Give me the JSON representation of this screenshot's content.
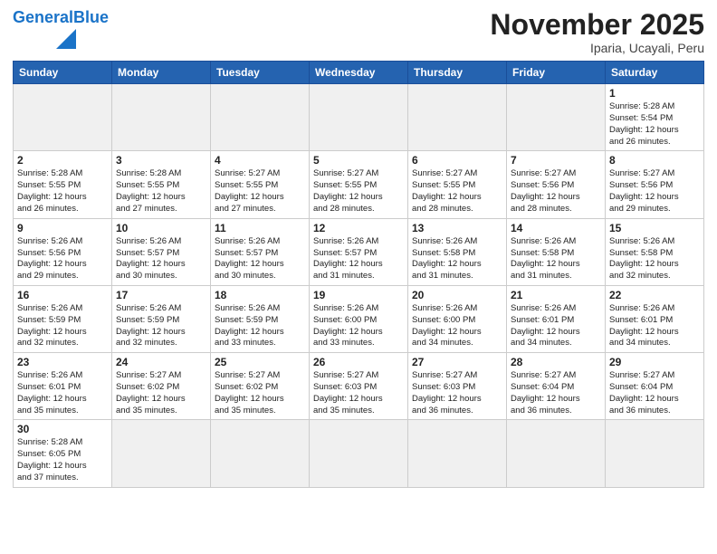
{
  "logo": {
    "text_general": "General",
    "text_blue": "Blue"
  },
  "title": "November 2025",
  "subtitle": "Iparia, Ucayali, Peru",
  "weekdays": [
    "Sunday",
    "Monday",
    "Tuesday",
    "Wednesday",
    "Thursday",
    "Friday",
    "Saturday"
  ],
  "weeks": [
    [
      {
        "day": "",
        "info": ""
      },
      {
        "day": "",
        "info": ""
      },
      {
        "day": "",
        "info": ""
      },
      {
        "day": "",
        "info": ""
      },
      {
        "day": "",
        "info": ""
      },
      {
        "day": "",
        "info": ""
      },
      {
        "day": "1",
        "info": "Sunrise: 5:28 AM\nSunset: 5:54 PM\nDaylight: 12 hours\nand 26 minutes."
      }
    ],
    [
      {
        "day": "2",
        "info": "Sunrise: 5:28 AM\nSunset: 5:55 PM\nDaylight: 12 hours\nand 26 minutes."
      },
      {
        "day": "3",
        "info": "Sunrise: 5:28 AM\nSunset: 5:55 PM\nDaylight: 12 hours\nand 27 minutes."
      },
      {
        "day": "4",
        "info": "Sunrise: 5:27 AM\nSunset: 5:55 PM\nDaylight: 12 hours\nand 27 minutes."
      },
      {
        "day": "5",
        "info": "Sunrise: 5:27 AM\nSunset: 5:55 PM\nDaylight: 12 hours\nand 28 minutes."
      },
      {
        "day": "6",
        "info": "Sunrise: 5:27 AM\nSunset: 5:55 PM\nDaylight: 12 hours\nand 28 minutes."
      },
      {
        "day": "7",
        "info": "Sunrise: 5:27 AM\nSunset: 5:56 PM\nDaylight: 12 hours\nand 28 minutes."
      },
      {
        "day": "8",
        "info": "Sunrise: 5:27 AM\nSunset: 5:56 PM\nDaylight: 12 hours\nand 29 minutes."
      }
    ],
    [
      {
        "day": "9",
        "info": "Sunrise: 5:26 AM\nSunset: 5:56 PM\nDaylight: 12 hours\nand 29 minutes."
      },
      {
        "day": "10",
        "info": "Sunrise: 5:26 AM\nSunset: 5:57 PM\nDaylight: 12 hours\nand 30 minutes."
      },
      {
        "day": "11",
        "info": "Sunrise: 5:26 AM\nSunset: 5:57 PM\nDaylight: 12 hours\nand 30 minutes."
      },
      {
        "day": "12",
        "info": "Sunrise: 5:26 AM\nSunset: 5:57 PM\nDaylight: 12 hours\nand 31 minutes."
      },
      {
        "day": "13",
        "info": "Sunrise: 5:26 AM\nSunset: 5:58 PM\nDaylight: 12 hours\nand 31 minutes."
      },
      {
        "day": "14",
        "info": "Sunrise: 5:26 AM\nSunset: 5:58 PM\nDaylight: 12 hours\nand 31 minutes."
      },
      {
        "day": "15",
        "info": "Sunrise: 5:26 AM\nSunset: 5:58 PM\nDaylight: 12 hours\nand 32 minutes."
      }
    ],
    [
      {
        "day": "16",
        "info": "Sunrise: 5:26 AM\nSunset: 5:59 PM\nDaylight: 12 hours\nand 32 minutes."
      },
      {
        "day": "17",
        "info": "Sunrise: 5:26 AM\nSunset: 5:59 PM\nDaylight: 12 hours\nand 32 minutes."
      },
      {
        "day": "18",
        "info": "Sunrise: 5:26 AM\nSunset: 5:59 PM\nDaylight: 12 hours\nand 33 minutes."
      },
      {
        "day": "19",
        "info": "Sunrise: 5:26 AM\nSunset: 6:00 PM\nDaylight: 12 hours\nand 33 minutes."
      },
      {
        "day": "20",
        "info": "Sunrise: 5:26 AM\nSunset: 6:00 PM\nDaylight: 12 hours\nand 34 minutes."
      },
      {
        "day": "21",
        "info": "Sunrise: 5:26 AM\nSunset: 6:01 PM\nDaylight: 12 hours\nand 34 minutes."
      },
      {
        "day": "22",
        "info": "Sunrise: 5:26 AM\nSunset: 6:01 PM\nDaylight: 12 hours\nand 34 minutes."
      }
    ],
    [
      {
        "day": "23",
        "info": "Sunrise: 5:26 AM\nSunset: 6:01 PM\nDaylight: 12 hours\nand 35 minutes."
      },
      {
        "day": "24",
        "info": "Sunrise: 5:27 AM\nSunset: 6:02 PM\nDaylight: 12 hours\nand 35 minutes."
      },
      {
        "day": "25",
        "info": "Sunrise: 5:27 AM\nSunset: 6:02 PM\nDaylight: 12 hours\nand 35 minutes."
      },
      {
        "day": "26",
        "info": "Sunrise: 5:27 AM\nSunset: 6:03 PM\nDaylight: 12 hours\nand 35 minutes."
      },
      {
        "day": "27",
        "info": "Sunrise: 5:27 AM\nSunset: 6:03 PM\nDaylight: 12 hours\nand 36 minutes."
      },
      {
        "day": "28",
        "info": "Sunrise: 5:27 AM\nSunset: 6:04 PM\nDaylight: 12 hours\nand 36 minutes."
      },
      {
        "day": "29",
        "info": "Sunrise: 5:27 AM\nSunset: 6:04 PM\nDaylight: 12 hours\nand 36 minutes."
      }
    ],
    [
      {
        "day": "30",
        "info": "Sunrise: 5:28 AM\nSunset: 6:05 PM\nDaylight: 12 hours\nand 37 minutes."
      },
      {
        "day": "",
        "info": ""
      },
      {
        "day": "",
        "info": ""
      },
      {
        "day": "",
        "info": ""
      },
      {
        "day": "",
        "info": ""
      },
      {
        "day": "",
        "info": ""
      },
      {
        "day": "",
        "info": ""
      }
    ]
  ]
}
